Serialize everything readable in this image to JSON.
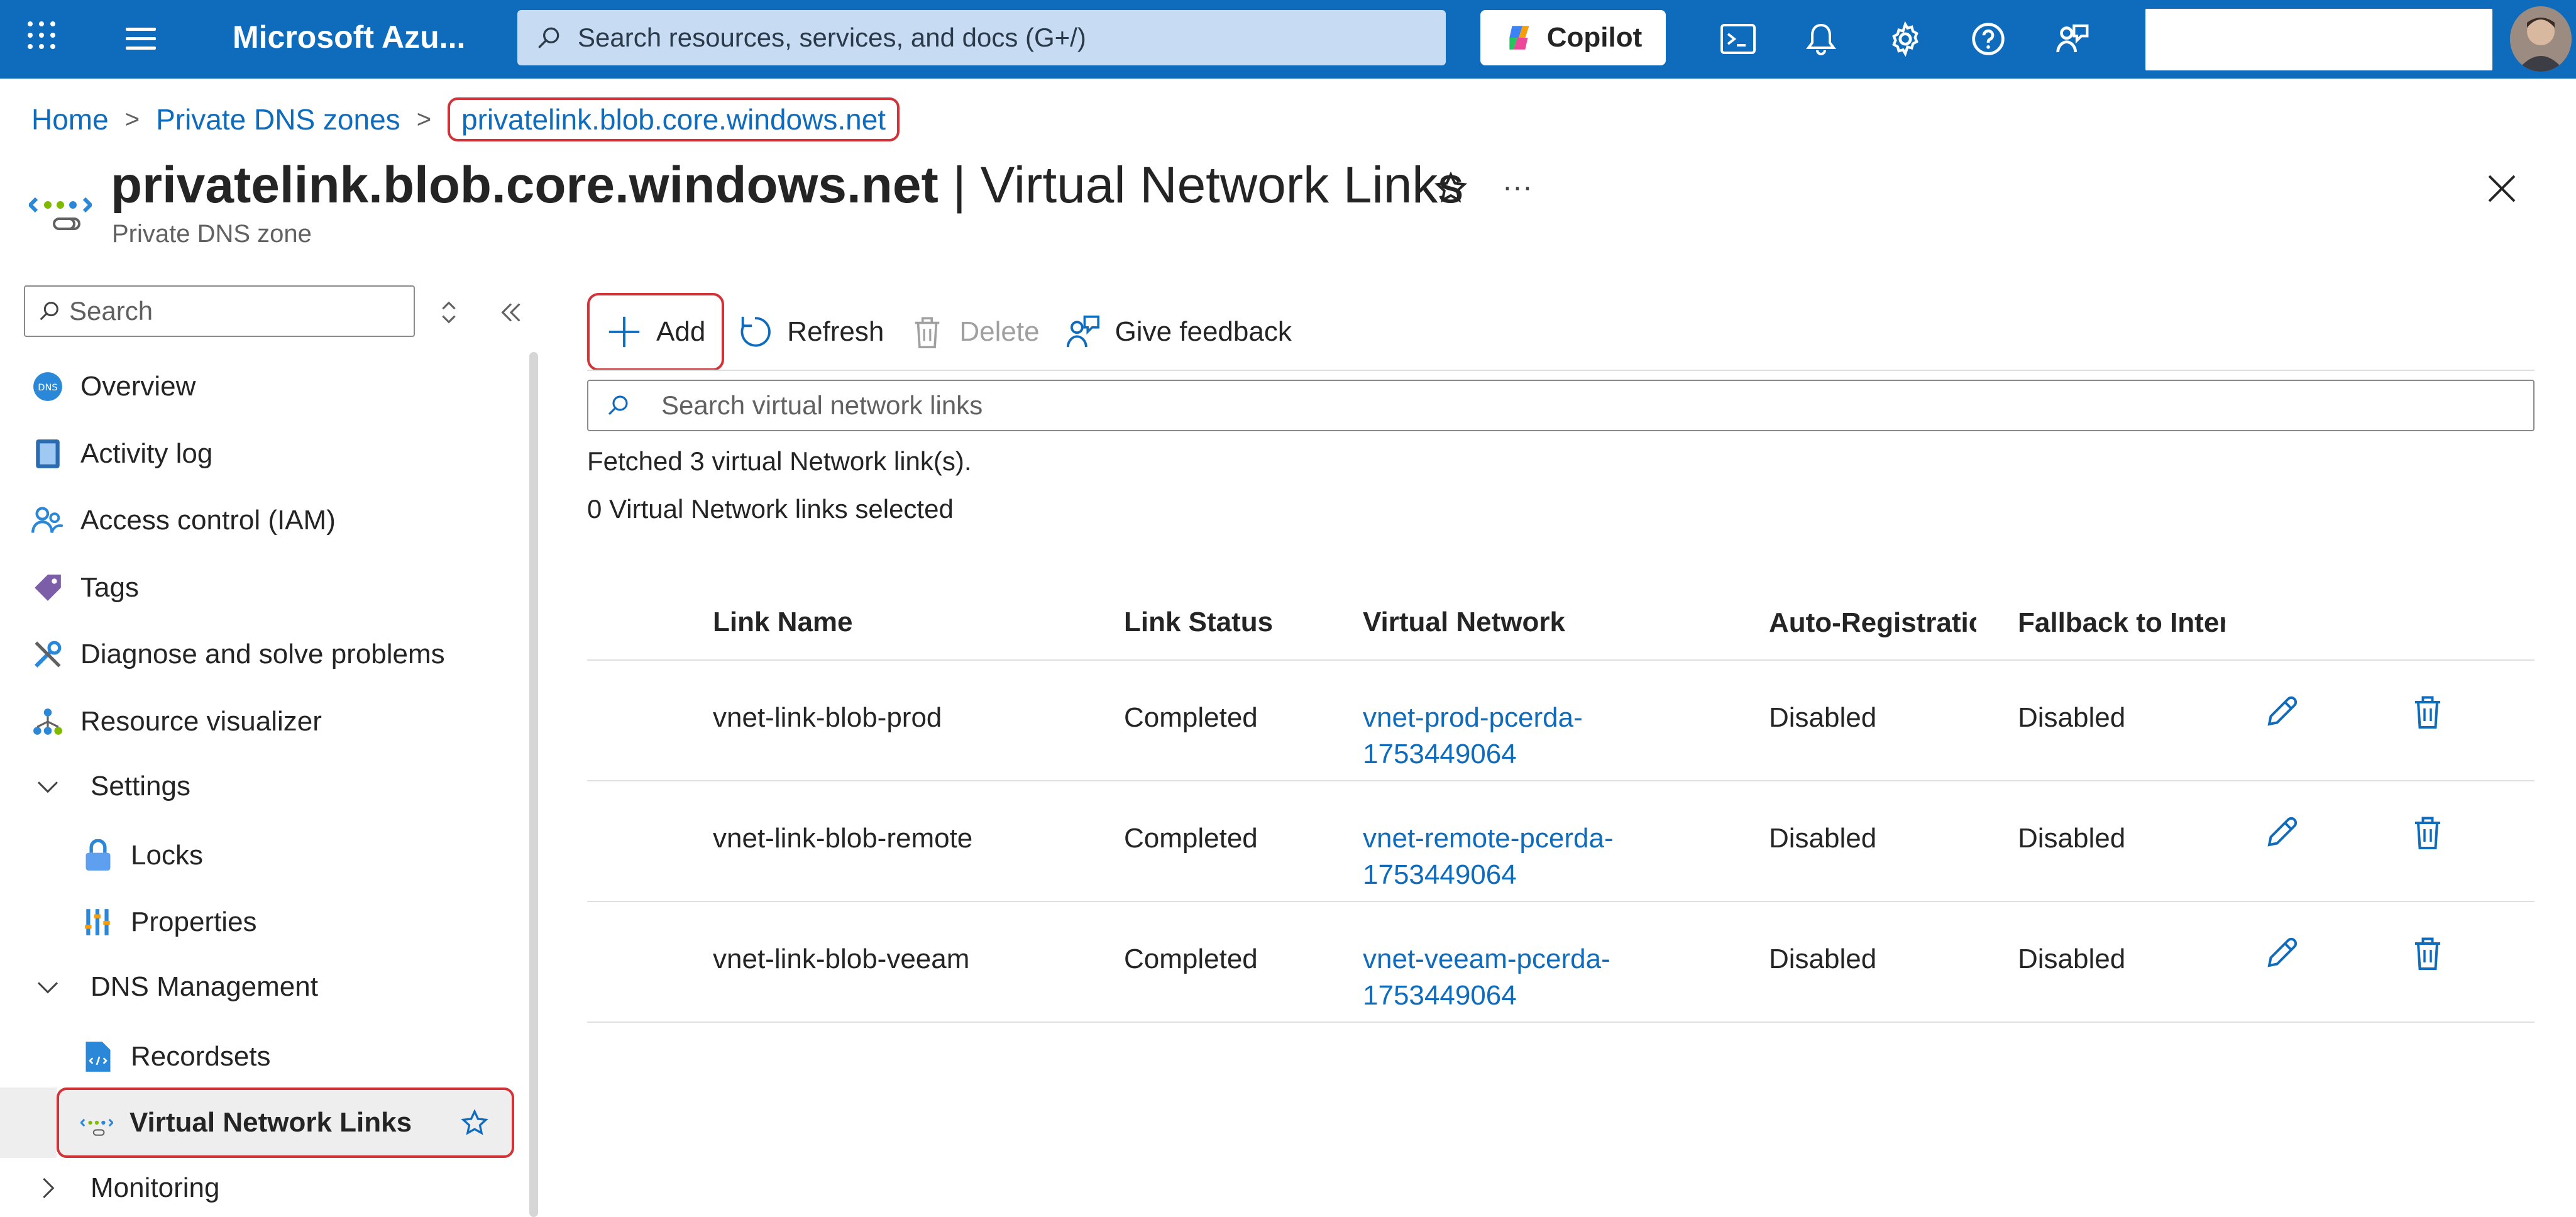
{
  "topbar": {
    "brand": "Microsoft Azu...",
    "search_placeholder": "Search resources, services, and docs (G+/)",
    "copilot_label": "Copilot",
    "icons": [
      "waffle-icon",
      "hamburger-icon",
      "cloud-shell-icon",
      "bell-icon",
      "gear-icon",
      "help-icon",
      "feedback-icon"
    ],
    "brand_color": "#0f6cbd"
  },
  "breadcrumb": {
    "items": [
      "Home",
      "Private DNS zones",
      "privatelink.blob.core.windows.net"
    ]
  },
  "header": {
    "title_main": "privatelink.blob.core.windows.net",
    "title_rest": " | Virtual Network Links",
    "subtitle": "Private DNS zone",
    "more": "···"
  },
  "sidebar": {
    "search_placeholder": "Search",
    "items": [
      {
        "label": "Overview",
        "icon": "dns-icon"
      },
      {
        "label": "Activity log",
        "icon": "activity-log-icon"
      },
      {
        "label": "Access control (IAM)",
        "icon": "people-icon"
      },
      {
        "label": "Tags",
        "icon": "tag-icon"
      },
      {
        "label": "Diagnose and solve problems",
        "icon": "wrench-icon"
      },
      {
        "label": "Resource visualizer",
        "icon": "hierarchy-icon"
      },
      {
        "label": "Settings",
        "icon": "chevron-down-icon"
      },
      {
        "label": "Locks",
        "icon": "lock-icon"
      },
      {
        "label": "Properties",
        "icon": "properties-icon"
      },
      {
        "label": "DNS Management",
        "icon": "chevron-down-icon"
      },
      {
        "label": "Recordsets",
        "icon": "recordset-icon"
      },
      {
        "label": "Virtual Network Links",
        "icon": "vnet-link-icon"
      },
      {
        "label": "Monitoring",
        "icon": "chevron-right-icon"
      }
    ]
  },
  "toolbar": {
    "add": "Add",
    "refresh": "Refresh",
    "delete": "Delete",
    "feedback": "Give feedback"
  },
  "filter_placeholder": "Search virtual network links",
  "status": {
    "fetched": "Fetched 3 virtual Network link(s).",
    "selected": "0 Virtual Network links selected"
  },
  "table": {
    "headers": [
      "Link Name",
      "Link Status",
      "Virtual Network",
      "Auto-Registratio",
      "Fallback to Interr"
    ],
    "rows": [
      {
        "name": "vnet-link-blob-prod",
        "status": "Completed",
        "vnet": "vnet-prod-pcerda-1753449064",
        "auto": "Disabled",
        "fallback": "Disabled"
      },
      {
        "name": "vnet-link-blob-remote",
        "status": "Completed",
        "vnet": "vnet-remote-pcerda-1753449064",
        "auto": "Disabled",
        "fallback": "Disabled"
      },
      {
        "name": "vnet-link-blob-veeam",
        "status": "Completed",
        "vnet": "vnet-veeam-pcerda-1753449064",
        "auto": "Disabled",
        "fallback": "Disabled"
      }
    ]
  }
}
